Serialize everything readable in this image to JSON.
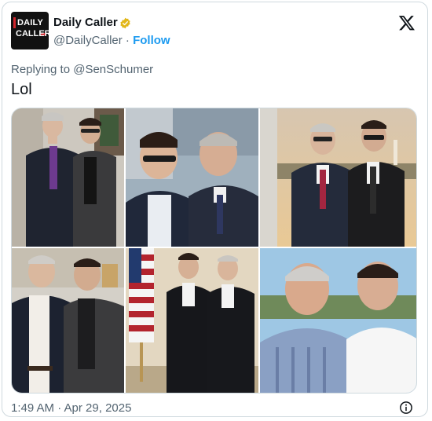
{
  "account": {
    "name": "Daily Caller",
    "handle": "@DailyCaller",
    "separator": "·",
    "follow_label": "Follow",
    "avatar_text_line1": "DAILY",
    "avatar_text_line2": "CALLER"
  },
  "tweet": {
    "replying_prefix": "Replying to ",
    "replying_to": "@SenSchumer",
    "text": "Lol",
    "timestamp": "1:49 AM · Apr 29, 2025"
  },
  "media": {
    "photo_count": 6,
    "photos": [
      {
        "description": "photo-1"
      },
      {
        "description": "photo-2"
      },
      {
        "description": "photo-3"
      },
      {
        "description": "photo-4"
      },
      {
        "description": "photo-5"
      },
      {
        "description": "photo-6"
      }
    ]
  },
  "icons": {
    "verified": "verified-badge-icon",
    "x_logo": "x-logo-icon",
    "info": "info-icon"
  },
  "colors": {
    "accent": "#1d9bf0",
    "verified": "#e2b719",
    "secondary_text": "#536471",
    "brand_red": "#d0242b"
  }
}
